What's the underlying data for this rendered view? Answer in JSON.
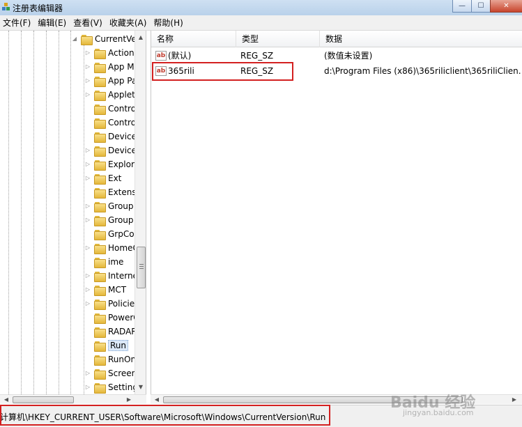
{
  "window": {
    "title": "注册表编辑器",
    "minimize_glyph": "—",
    "maximize_glyph": "☐",
    "close_glyph": "✕"
  },
  "menu": [
    "文件(F)",
    "编辑(E)",
    "查看(V)",
    "收藏夹(A)",
    "帮助(H)"
  ],
  "tree": {
    "parent": "CurrentVe",
    "items": [
      {
        "label": "Action",
        "expandable": true
      },
      {
        "label": "App M",
        "expandable": true
      },
      {
        "label": "App Pa",
        "expandable": true
      },
      {
        "label": "Applet",
        "expandable": true
      },
      {
        "label": "Contro",
        "expandable": false
      },
      {
        "label": "Contro",
        "expandable": false
      },
      {
        "label": "Device",
        "expandable": false
      },
      {
        "label": "Device",
        "expandable": true
      },
      {
        "label": "Explor",
        "expandable": true
      },
      {
        "label": "Ext",
        "expandable": true
      },
      {
        "label": "Extens",
        "expandable": false
      },
      {
        "label": "Group",
        "expandable": true
      },
      {
        "label": "Group",
        "expandable": true
      },
      {
        "label": "GrpCo",
        "expandable": false
      },
      {
        "label": "HomeG",
        "expandable": true
      },
      {
        "label": "ime",
        "expandable": false
      },
      {
        "label": "Interne",
        "expandable": true
      },
      {
        "label": "MCT",
        "expandable": true
      },
      {
        "label": "Policie",
        "expandable": true
      },
      {
        "label": "PowerC",
        "expandable": false
      },
      {
        "label": "RADAR",
        "expandable": false
      },
      {
        "label": "Run",
        "expandable": false,
        "selected": true
      },
      {
        "label": "RunOn",
        "expandable": false
      },
      {
        "label": "Screen",
        "expandable": true
      },
      {
        "label": "Setting",
        "expandable": true
      }
    ]
  },
  "list": {
    "columns": [
      "名称",
      "类型",
      "数据"
    ],
    "rows": [
      {
        "name": "(默认)",
        "type": "REG_SZ",
        "data": "(数值未设置)"
      },
      {
        "name": "365rili",
        "type": "REG_SZ",
        "data": "d:\\Program Files (x86)\\365riliclient\\365riliClien..."
      }
    ]
  },
  "icons": {
    "value_icon_text": "ab",
    "app_icon": "registry-cubes-icon",
    "folder_icon": "folder-icon"
  },
  "status": {
    "path": "计算机\\HKEY_CURRENT_USER\\Software\\Microsoft\\Windows\\CurrentVersion\\Run"
  },
  "watermark": {
    "main": "Baidu 经验",
    "sub": "jingyan.baidu.com"
  },
  "colors": {
    "highlight_red": "#d32020",
    "selection_blue": "#dbe8f8"
  }
}
